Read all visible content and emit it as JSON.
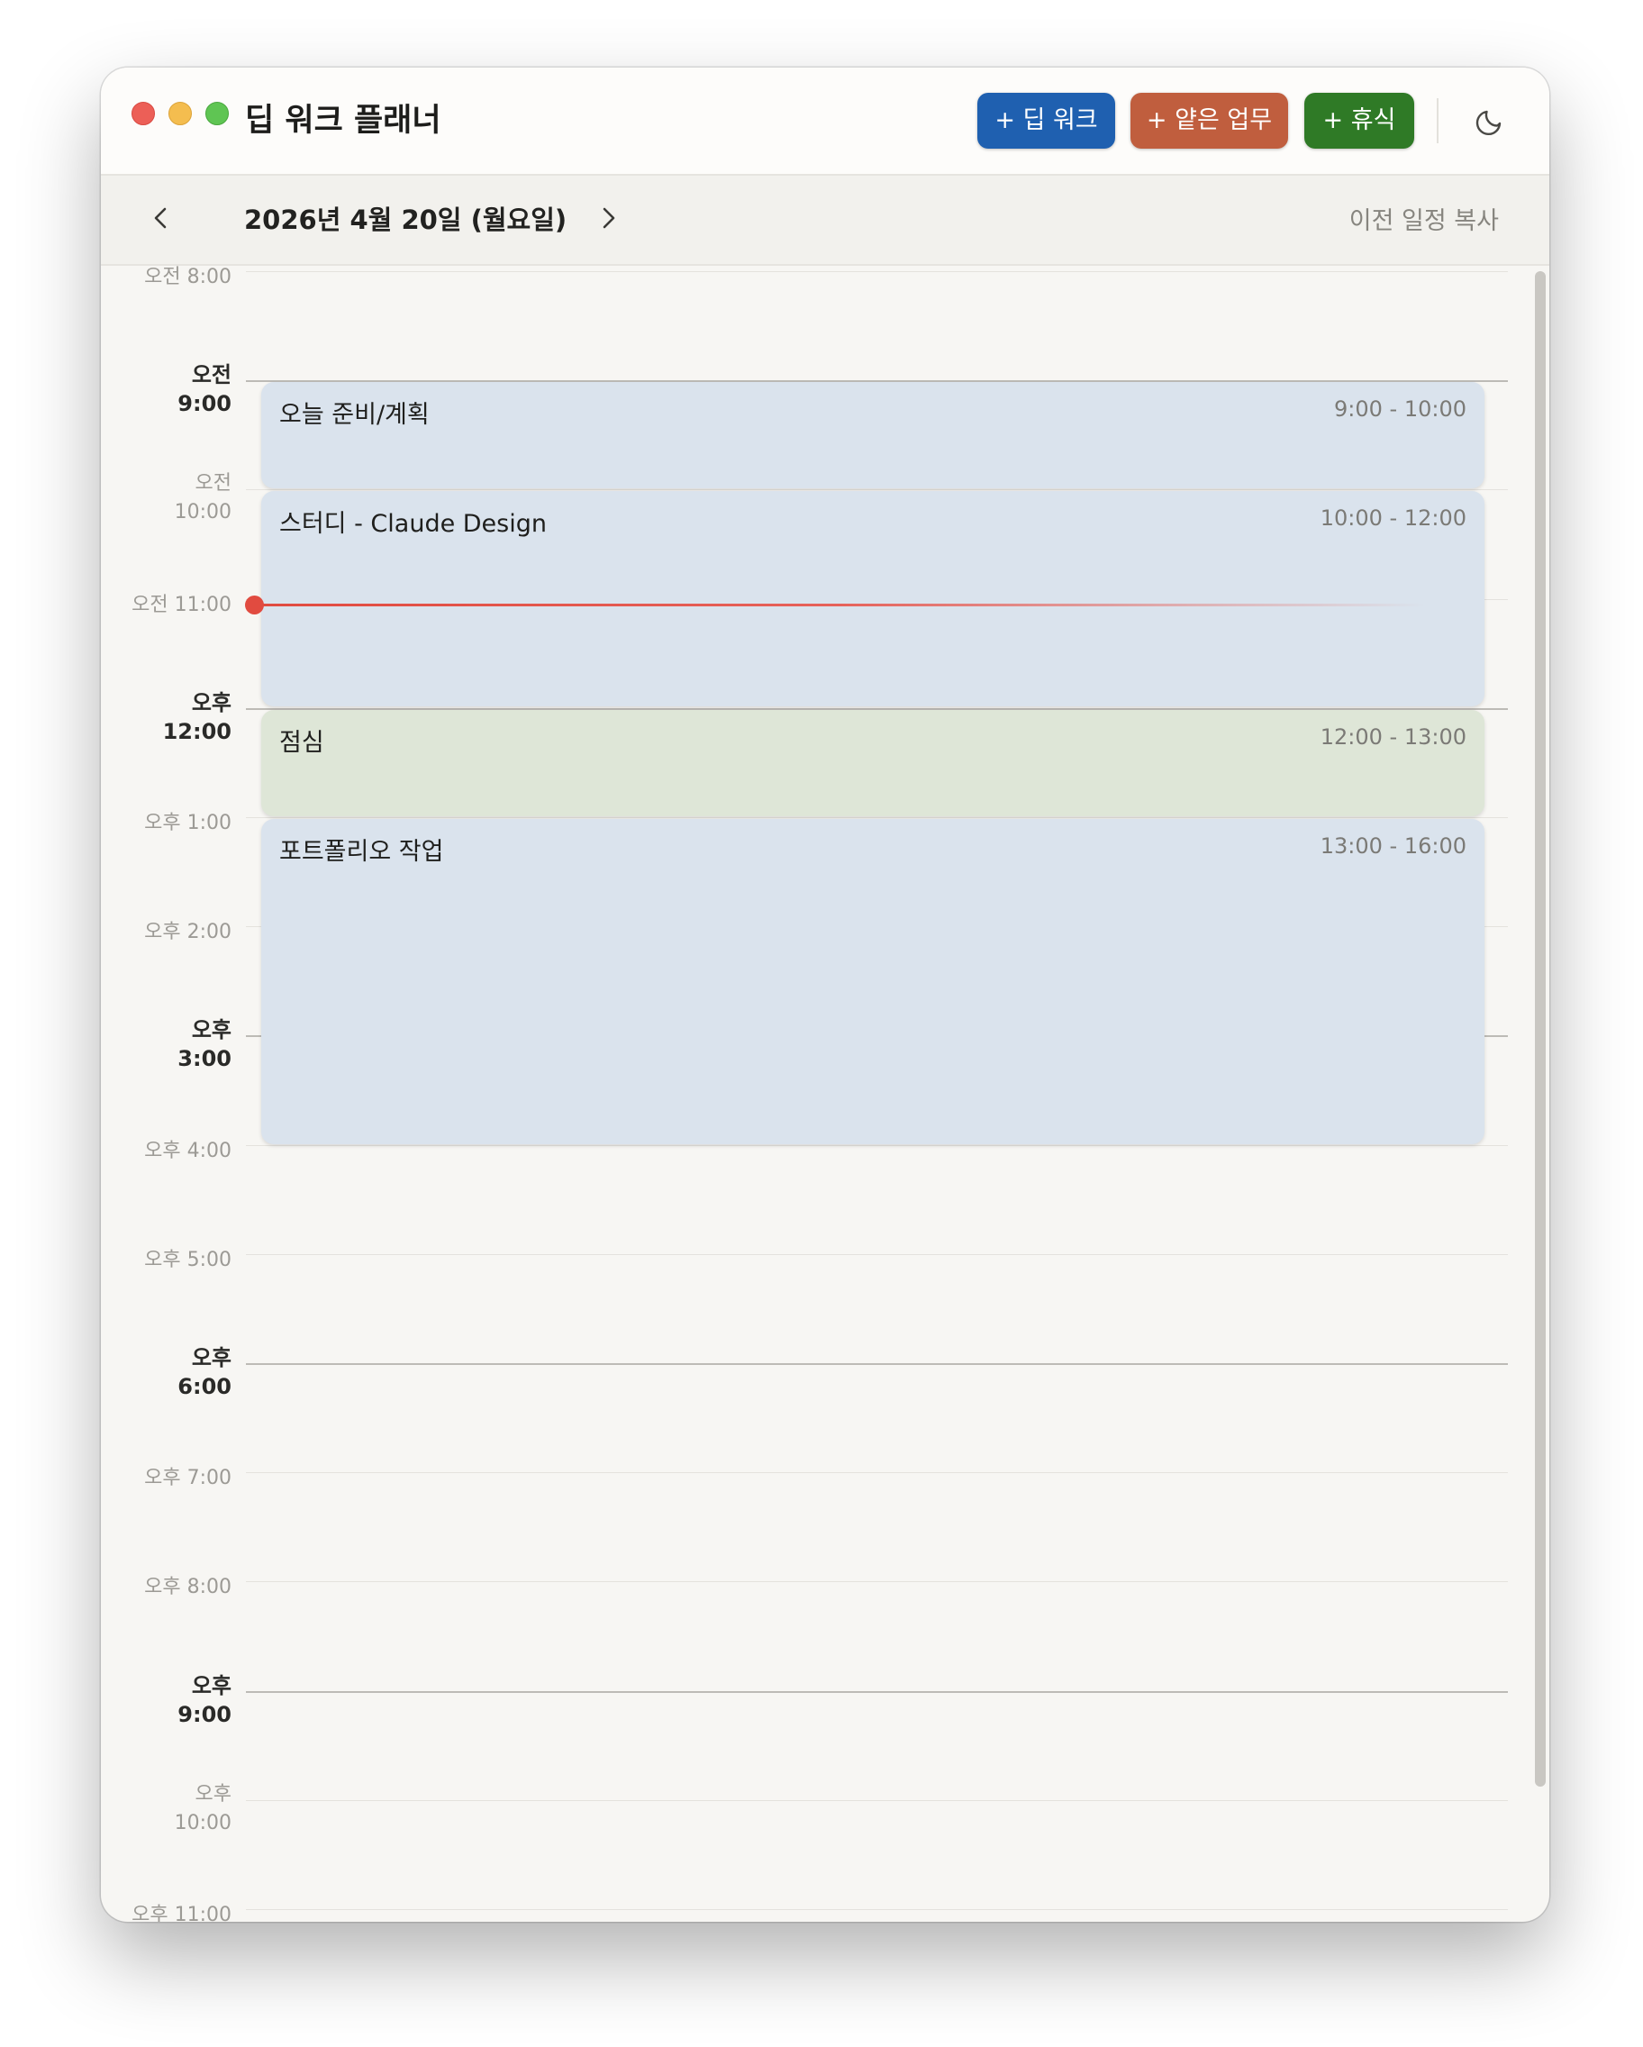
{
  "window": {
    "title": "딥 워크 플래너",
    "buttons": {
      "deep_work": "+ 딥 워크",
      "shallow_work": "+ 얕은 업무",
      "rest": "+ 휴식"
    },
    "colors": {
      "deep_work": "#1f60b0",
      "shallow_work": "#c05e3e",
      "rest": "#2f7a26",
      "now_indicator": "#e14b40"
    }
  },
  "datebar": {
    "date": "2026년 4월 20일 (월요일)",
    "copy_previous": "이전 일정 복사"
  },
  "hours": [
    {
      "period": "오전",
      "time": "8:00"
    },
    {
      "period": "오전",
      "time": "9:00"
    },
    {
      "period": "오전",
      "time": "10:00"
    },
    {
      "period": "오전",
      "time": "11:00"
    },
    {
      "period": "오후",
      "time": "12:00"
    },
    {
      "period": "오후",
      "time": "1:00"
    },
    {
      "period": "오후",
      "time": "2:00"
    },
    {
      "period": "오후",
      "time": "3:00"
    },
    {
      "period": "오후",
      "time": "4:00"
    },
    {
      "period": "오후",
      "time": "5:00"
    },
    {
      "period": "오후",
      "time": "6:00"
    },
    {
      "period": "오후",
      "time": "7:00"
    },
    {
      "period": "오후",
      "time": "8:00"
    },
    {
      "period": "오후",
      "time": "9:00"
    },
    {
      "period": "오후",
      "time": "10:00"
    },
    {
      "period": "오후",
      "time": "11:00"
    }
  ],
  "events": [
    {
      "title": "오늘 준비/계획",
      "time": "9:00 - 10:00",
      "type": "deep"
    },
    {
      "title": "스터디 - Claude Design",
      "time": "10:00 - 12:00",
      "type": "deep"
    },
    {
      "title": "점심",
      "time": "12:00 - 13:00",
      "type": "lunch"
    },
    {
      "title": "포트폴리오 작업",
      "time": "13:00 - 16:00",
      "type": "deep"
    }
  ]
}
